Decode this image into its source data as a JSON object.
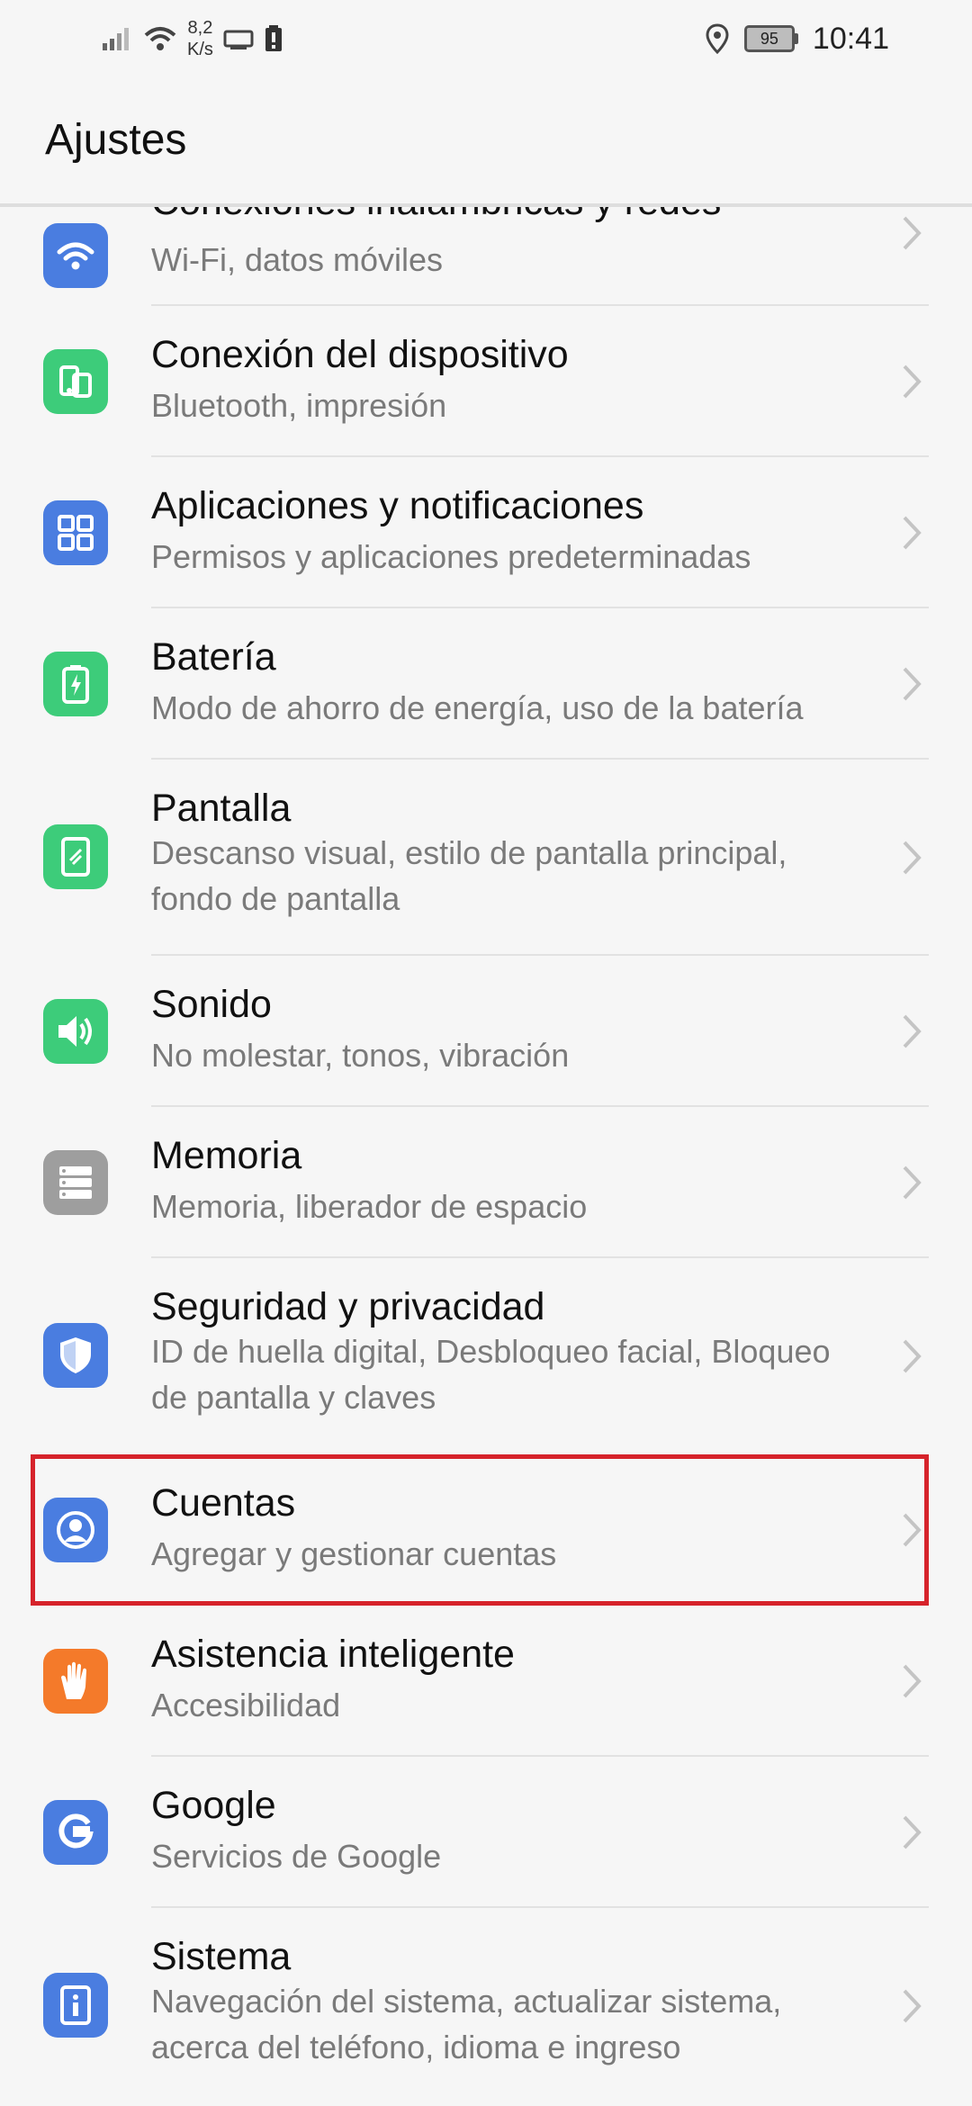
{
  "status_bar": {
    "net_speed_value": "8,2",
    "net_speed_unit": "K/s",
    "battery_level": "95",
    "time": "10:41"
  },
  "header": {
    "title": "Ajustes"
  },
  "settings": [
    {
      "title": "Conexiones inalámbricas y redes",
      "subtitle": "Wi-Fi, datos móviles",
      "icon": "wifi-icon",
      "color": "#4a7de0"
    },
    {
      "title": "Conexión del dispositivo",
      "subtitle": "Bluetooth, impresión",
      "icon": "device-connection-icon",
      "color": "#3dcc7a"
    },
    {
      "title": "Aplicaciones y notificaciones",
      "subtitle": "Permisos y aplicaciones predeterminadas",
      "icon": "apps-grid-icon",
      "color": "#4a7de0"
    },
    {
      "title": "Batería",
      "subtitle": "Modo de ahorro de energía, uso de la batería",
      "icon": "battery-icon",
      "color": "#3dcc7a"
    },
    {
      "title": "Pantalla",
      "subtitle": "Descanso visual, estilo de pantalla principal, fondo de pantalla",
      "icon": "display-icon",
      "color": "#3dcc7a"
    },
    {
      "title": "Sonido",
      "subtitle": "No molestar, tonos, vibración",
      "icon": "speaker-icon",
      "color": "#3dcc7a"
    },
    {
      "title": "Memoria",
      "subtitle": "Memoria, liberador de espacio",
      "icon": "storage-icon",
      "color": "#9e9e9e"
    },
    {
      "title": "Seguridad y privacidad",
      "subtitle": "ID de huella digital, Desbloqueo facial, Bloqueo de pantalla y claves",
      "icon": "shield-icon",
      "color": "#4a7de0"
    },
    {
      "title": "Cuentas",
      "subtitle": "Agregar y gestionar cuentas",
      "icon": "account-icon",
      "color": "#4a7de0"
    },
    {
      "title": "Asistencia inteligente",
      "subtitle": "Accesibilidad",
      "icon": "hand-icon",
      "color": "#f47a2a"
    },
    {
      "title": "Google",
      "subtitle": "Servicios de Google",
      "icon": "google-icon",
      "color": "#4a7de0"
    },
    {
      "title": "Sistema",
      "subtitle": "Navegación del sistema, actualizar sistema, acerca del teléfono, idioma e ingreso",
      "icon": "info-icon",
      "color": "#4a7de0"
    }
  ]
}
